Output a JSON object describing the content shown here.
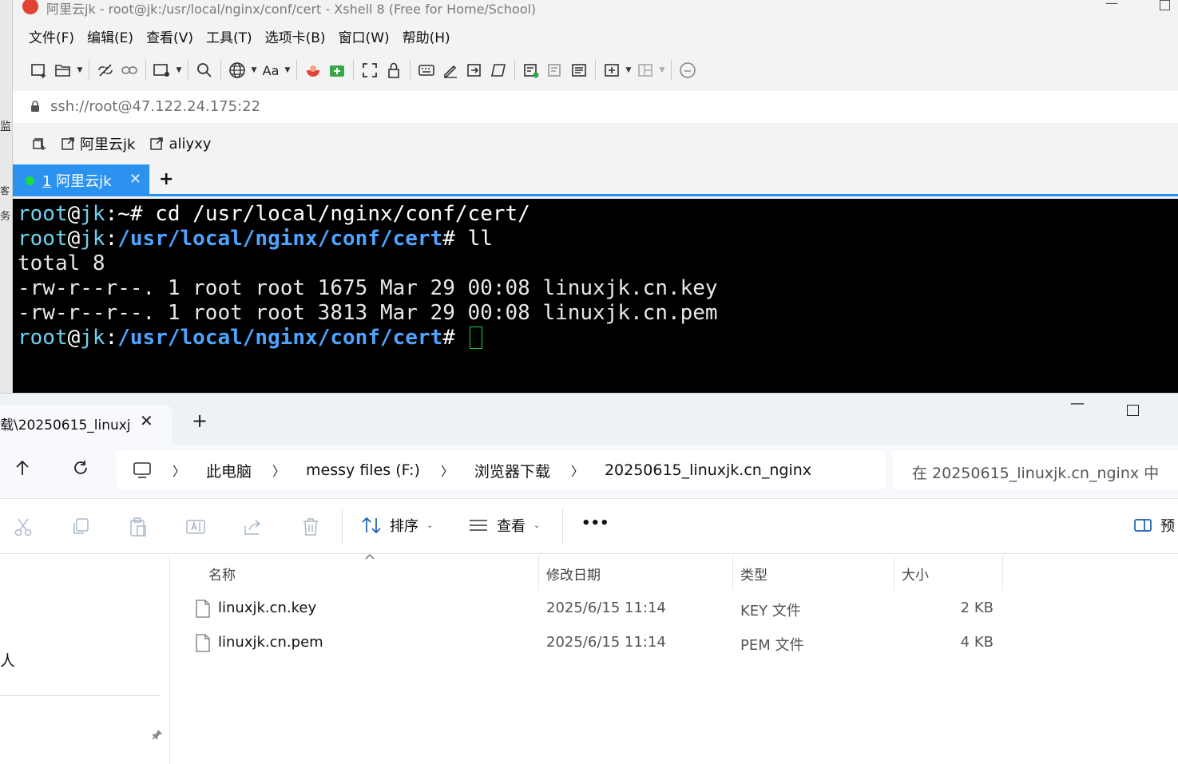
{
  "background_window": {
    "fragments": [
      "监",
      "客",
      "务"
    ]
  },
  "xshell": {
    "title": "阿里云jk - root@jk:/usr/local/nginx/conf/cert - Xshell 8 (Free for Home/School)",
    "menu": [
      "文件(F)",
      "编辑(E)",
      "查看(V)",
      "工具(T)",
      "选项卡(B)",
      "窗口(W)",
      "帮助(H)"
    ],
    "toolbar": {
      "font_label": "Aa",
      "icons": [
        "new-session-icon",
        "open-folder-icon",
        "disconnect-icon",
        "link-icon",
        "new-window-icon",
        "search-icon",
        "globe-icon",
        "font-icon",
        "xshell-logo-icon",
        "xftp-icon",
        "fullscreen-icon",
        "lock-icon",
        "keyboard-icon",
        "pen-icon",
        "send-icon",
        "script-icon",
        "log-icon",
        "compose-icon",
        "list-icon",
        "add-tab-icon",
        "layout-icon",
        "chat-icon"
      ]
    },
    "address": "ssh://root@47.122.24.175:22",
    "quick_links": [
      "阿里云jk",
      "aliyxy"
    ],
    "active_tab": {
      "number": "1",
      "label": "阿里云jk",
      "status_color": "#19e039"
    },
    "terminal": {
      "lines": [
        {
          "user": "root",
          "at": "@",
          "host": "jk",
          "colon": ":",
          "path": "~",
          "prompt": "# ",
          "command": "cd /usr/local/nginx/conf/cert/"
        },
        {
          "user": "root",
          "at": "@",
          "host": "jk",
          "colon": ":",
          "path": "/usr/local/nginx/conf/cert",
          "prompt": "# ",
          "command": "ll"
        },
        {
          "output": "total 8"
        },
        {
          "output": "-rw-r--r--. 1 root root 1675 Mar 29 00:08 linuxjk.cn.key"
        },
        {
          "output": "-rw-r--r--. 1 root root 3813 Mar 29 00:08 linuxjk.cn.pem"
        },
        {
          "user": "root",
          "at": "@",
          "host": "jk",
          "colon": ":",
          "path": "/usr/local/nginx/conf/cert",
          "prompt": "# ",
          "command": ""
        }
      ]
    }
  },
  "explorer": {
    "tab_title": "载\\20250615_linuxj",
    "breadcrumb": [
      "此电脑",
      "messy files (F:)",
      "浏览器下载",
      "20250615_linuxjk.cn_nginx"
    ],
    "search_placeholder": "在 20250615_linuxjk.cn_nginx 中",
    "commands": {
      "sort": "排序",
      "view": "查看",
      "more": "•••",
      "preview": "预"
    },
    "nav_fragment": "人",
    "columns": [
      "名称",
      "修改日期",
      "类型",
      "大小"
    ],
    "files": [
      {
        "name": "linuxjk.cn.key",
        "modified": "2025/6/15 11:14",
        "type": "KEY 文件",
        "size": "2 KB"
      },
      {
        "name": "linuxjk.cn.pem",
        "modified": "2025/6/15 11:14",
        "type": "PEM 文件",
        "size": "4 KB"
      }
    ]
  }
}
